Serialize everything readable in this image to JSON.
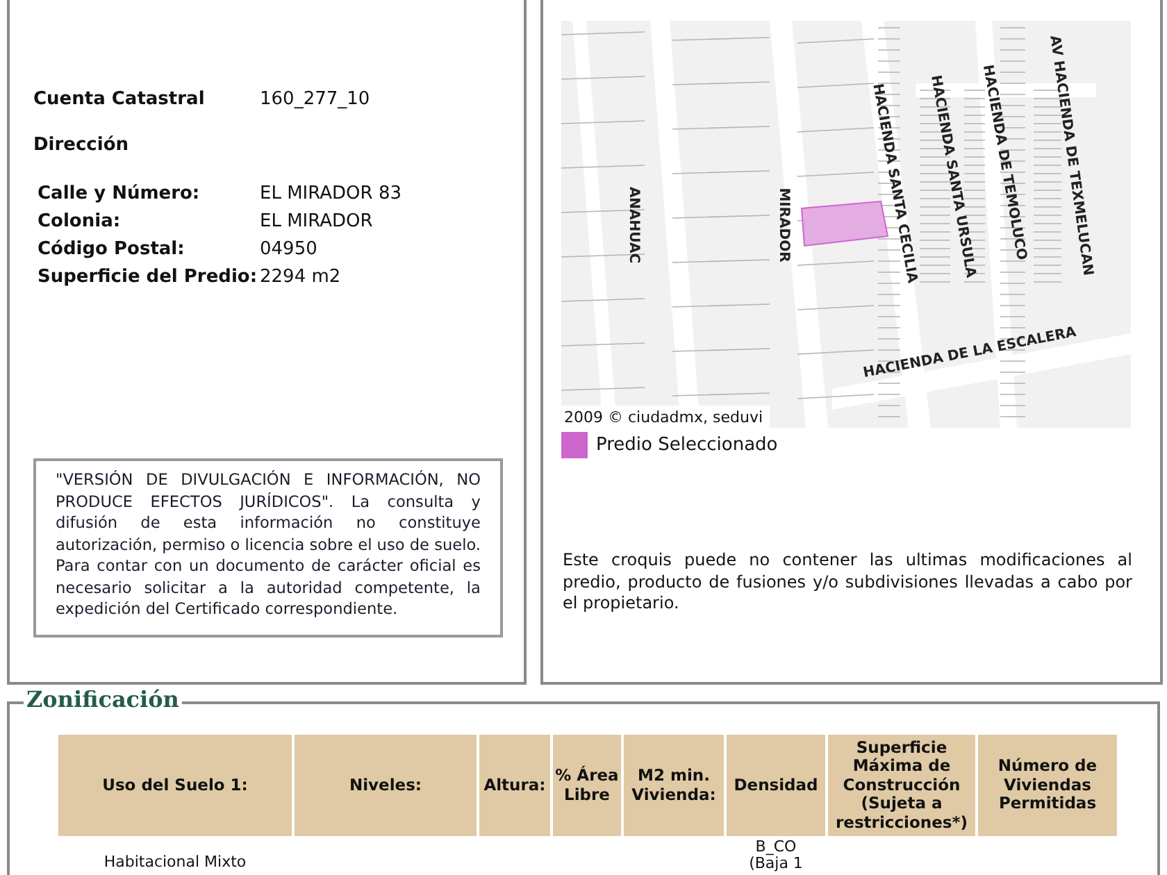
{
  "general_info": {
    "fields": [
      {
        "label": "Cuenta Catastral",
        "value": "160_277_10"
      }
    ],
    "address_heading": "Dirección",
    "address_fields": [
      {
        "label": "Calle y Número:",
        "value": "EL MIRADOR 83"
      },
      {
        "label": "Colonia:",
        "value": "EL MIRADOR"
      },
      {
        "label": "Código Postal:",
        "value": "04950"
      },
      {
        "label": "Superficie del Predio:",
        "value": "2294 m2"
      }
    ],
    "disclaimer": "\"VERSIÓN DE DIVULGACIÓN E INFORMACIÓN, NO PRODUCE EFECTOS JURÍDICOS\". La consulta y difusión de esta información no constituye autorización, permiso o licencia sobre el uso de suelo. Para contar con un documento de carácter oficial es necesario solicitar a la autoridad competente, la expedición del Certificado correspondiente."
  },
  "location": {
    "map": {
      "streets": [
        "ANAHUAC",
        "MIRADOR",
        "HACIENDA SANTA CECILIA",
        "HACIENDA SANTA URSULA",
        "HACIENDA DE TEMOLUCO",
        "AV HACIENDA DE TEXMELUCAN",
        "HACIENDA DE LA ESCALERA"
      ],
      "copyright": "2009 © ciudadmx, seduvi"
    },
    "legend": {
      "label": "Predio Seleccionado",
      "color": "#cc66cc"
    },
    "note": "Este croquis puede no contener las ultimas modificaciones al predio, producto de fusiones y/o subdivisiones llevadas a cabo por el propietario."
  },
  "zoning": {
    "title": "Zonificación",
    "columns": [
      "Uso del Suelo 1:",
      "Niveles:",
      "Altura:",
      "% Área Libre",
      "M2 min. Vivienda:",
      "Densidad",
      "Superficie Máxima de Construcción (Sujeta a restricciones*)",
      "Número de Viviendas Permitidas"
    ],
    "rows": [
      {
        "cells": [
          "Habitacional Mixto",
          "",
          "",
          "",
          "",
          "B_CO\n(Baja 1",
          "",
          ""
        ]
      }
    ]
  }
}
